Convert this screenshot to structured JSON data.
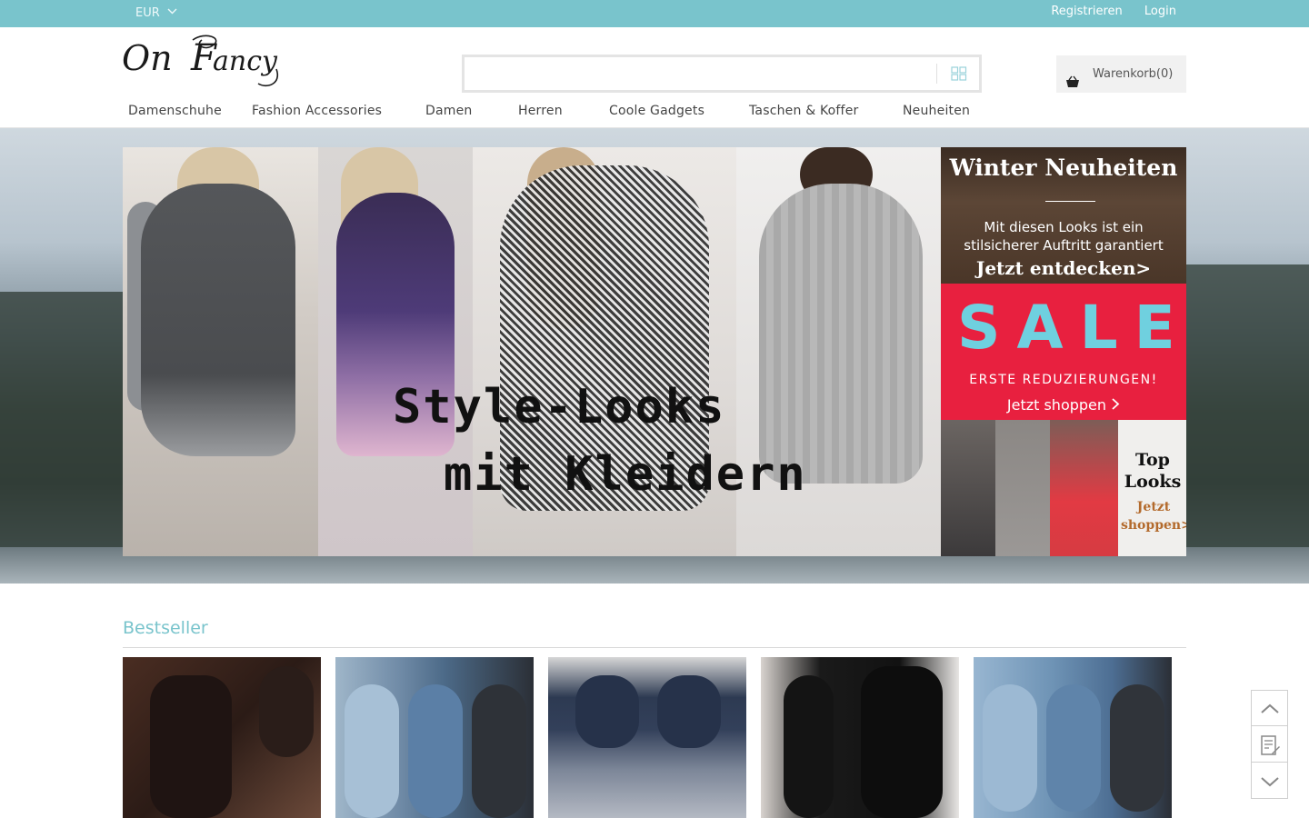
{
  "topbar": {
    "currency": "EUR",
    "register": "Registrieren",
    "login": "Login"
  },
  "brand": {
    "logo_text": "OnFancy"
  },
  "search": {
    "placeholder": "",
    "value": ""
  },
  "cart": {
    "label": "Warenkorb(0)"
  },
  "nav": {
    "items": [
      "Damenschuhe",
      "Fashion Accessories",
      "Damen",
      "Herren",
      "Coole Gadgets",
      "Taschen & Koffer",
      "Neuheiten"
    ]
  },
  "hero": {
    "line1": "Style-Looks",
    "line2": "mit Kleidern"
  },
  "promos": {
    "winter": {
      "title": "Winter Neuheiten",
      "text1": "Mit diesen Looks ist ein",
      "text2": "stilsicherer Auftritt garantiert",
      "cta": "Jetzt entdecken>"
    },
    "sale": {
      "title": "SALE",
      "subtitle": "ERSTE REDUZIERUNGEN!",
      "cta": "Jetzt shoppen"
    },
    "top": {
      "title1": "Top",
      "title2": "Looks",
      "cta1": "Jetzt",
      "cta2": "shoppen>"
    }
  },
  "bestseller": {
    "title": "Bestseller"
  },
  "colors": {
    "accent": "#79c4cc",
    "sale_red": "#e8203f",
    "sale_blue": "#6fd0df"
  },
  "icons": [
    "chevron-down-icon",
    "grid-search-icon",
    "basket-icon",
    "arrow-up-icon",
    "notepad-icon",
    "arrow-down-icon"
  ]
}
